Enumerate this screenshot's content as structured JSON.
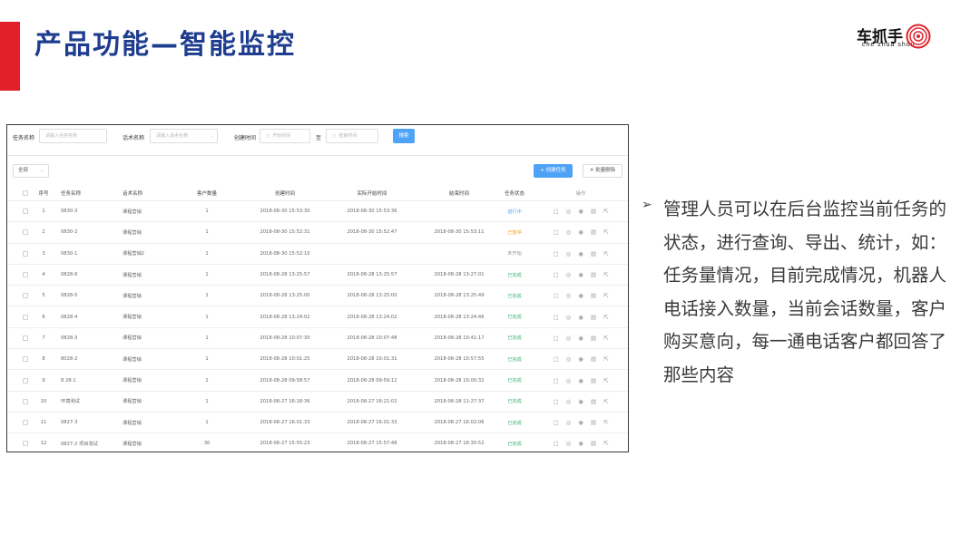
{
  "slide": {
    "title": "产品功能—智能监控",
    "accent_color": "#e1202b",
    "title_color": "#1f3d8f"
  },
  "logo": {
    "text": "车抓手",
    "pinyin": "che zhua shou",
    "mark_color": "#e1202b"
  },
  "filters": {
    "task_name_label": "任务名称",
    "task_name_placeholder": "请输入任务名称",
    "script_name_label": "话术名称",
    "script_name_placeholder": "请输入话术名称",
    "created_time_label": "创建时间",
    "start_placeholder": "开始时间",
    "to_label": "至",
    "end_placeholder": "结束时间",
    "search_label": "搜索"
  },
  "toolbar": {
    "status_filter": "全部",
    "create_label": "创建任务",
    "batch_delete_label": "批量删除",
    "accent_color": "#4fa3f7"
  },
  "table": {
    "headers": {
      "seq": "序号",
      "task": "任务名称",
      "script": "话术名称",
      "count": "客户数量",
      "created": "创建时间",
      "start": "实际开始时间",
      "end": "结束时间",
      "status": "任务状态",
      "ops": "操作"
    },
    "rows": [
      {
        "seq": "1",
        "task": "0830-3",
        "script": "课程营销",
        "count": "1",
        "created": "2018-08-30 15:53:30",
        "start": "2018-08-30 15:53:36",
        "end": "",
        "status": "进行中",
        "status_color": "#4fa3f7"
      },
      {
        "seq": "2",
        "task": "0830-2",
        "script": "课程营销",
        "count": "1",
        "created": "2018-08-30 15:52:31",
        "start": "2018-08-30 15:52:47",
        "end": "2018-08-30 15:53:11",
        "status": "已暂停",
        "status_color": "#f5a623"
      },
      {
        "seq": "3",
        "task": "0830-1",
        "script": "课程营销2",
        "count": "1",
        "created": "2018-08-30 15:52:10",
        "start": "",
        "end": "",
        "status": "未开始",
        "status_color": "#999999"
      },
      {
        "seq": "4",
        "task": "0828-6",
        "script": "课程营销",
        "count": "1",
        "created": "2018-08-28 13:25:57",
        "start": "2018-08-28 13:25:57",
        "end": "2018-08-28 13:27:01",
        "status": "已完成",
        "status_color": "#3cb371"
      },
      {
        "seq": "5",
        "task": "0828-5",
        "script": "课程营销",
        "count": "1",
        "created": "2018-08-28 13:25:00",
        "start": "2018-08-28 13:25:00",
        "end": "2018-08-28 13:25:49",
        "status": "已完成",
        "status_color": "#3cb371"
      },
      {
        "seq": "6",
        "task": "0828-4",
        "script": "课程营销",
        "count": "1",
        "created": "2018-08-28 13:24:02",
        "start": "2018-08-28 13:24:02",
        "end": "2018-08-28 13:24:46",
        "status": "已完成",
        "status_color": "#3cb371"
      },
      {
        "seq": "7",
        "task": "0828-3",
        "script": "课程营销",
        "count": "1",
        "created": "2018-08-28 10:07:30",
        "start": "2018-08-28 10:07:48",
        "end": "2018-08-28 10:41:17",
        "status": "已完成",
        "status_color": "#3cb371"
      },
      {
        "seq": "8",
        "task": "8028-2",
        "script": "课程营销",
        "count": "1",
        "created": "2018-08-28 10:01:25",
        "start": "2018-08-28 10:01:31",
        "end": "2018-08-28 10:57:55",
        "status": "已完成",
        "status_color": "#3cb371"
      },
      {
        "seq": "9",
        "task": "8 28-1",
        "script": "课程营销",
        "count": "1",
        "created": "2018-08-28 09:58:57",
        "start": "2018-08-28 09:59:12",
        "end": "2018-08-28 10:00:32",
        "status": "已完成",
        "status_color": "#3cb371"
      },
      {
        "seq": "10",
        "task": "环境测试",
        "script": "课程营销",
        "count": "1",
        "created": "2018-08-27 16:18:36",
        "start": "2018-08-27 16:21:02",
        "end": "2018-08-28 11:27:37",
        "status": "已完成",
        "status_color": "#3cb371"
      },
      {
        "seq": "11",
        "task": "0827-3",
        "script": "课程营销",
        "count": "1",
        "created": "2018-08-27 16:01:33",
        "start": "2018-08-27 16:01:33",
        "end": "2018-08-27 16:02:06",
        "status": "已完成",
        "status_color": "#3cb371"
      },
      {
        "seq": "12",
        "task": "0827-2 项目测试",
        "script": "课程营销",
        "count": "30",
        "created": "2018-08-27 15:55:23",
        "start": "2018-08-27 15:57:48",
        "end": "2018-08-27 16:30:52",
        "status": "已完成",
        "status_color": "#3cb371"
      }
    ]
  },
  "description": {
    "bullet": "➢",
    "text": "管理人员可以在后台监控当前任务的状态，进行查询、导出、统计，如：任务量情况，目前完成情况，机器人电话接入数量，当前会话数量，客户购买意向，每一通电话客户都回答了那些内容"
  }
}
